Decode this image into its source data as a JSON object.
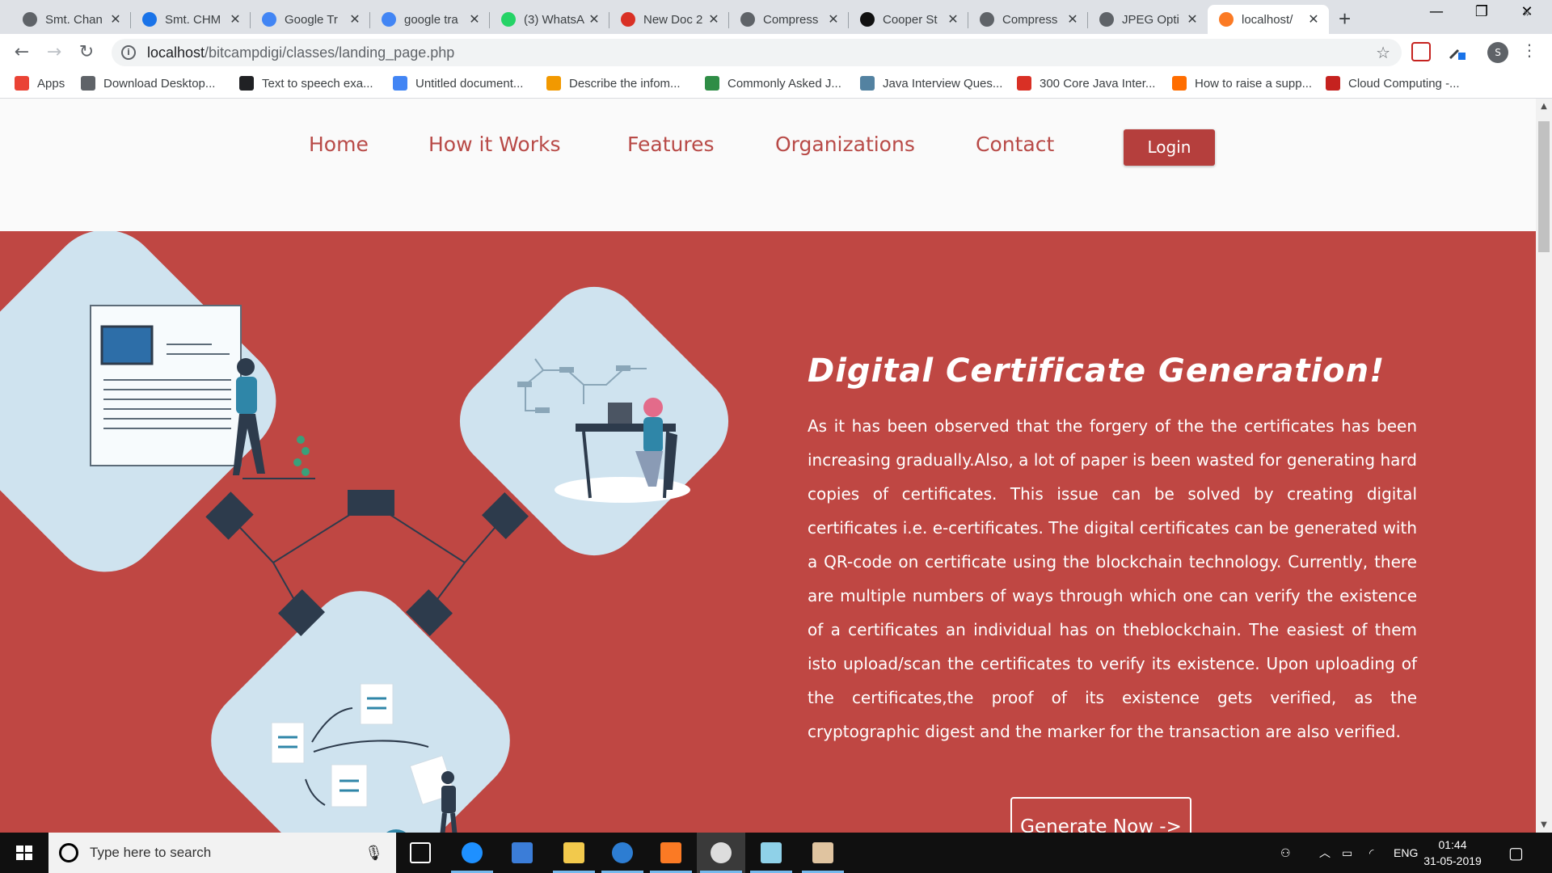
{
  "browser": {
    "tabs": [
      {
        "label": "Smt. Chan",
        "icon": "globe-icon",
        "color": "#5f6368"
      },
      {
        "label": "Smt. CHM",
        "icon": "a-logo-icon",
        "color": "#1a73e8"
      },
      {
        "label": "Google Tr",
        "icon": "google-translate-icon",
        "color": "#4285f4"
      },
      {
        "label": "google tra",
        "icon": "google-g-icon",
        "color": "#4285f4"
      },
      {
        "label": "(3) WhatsA",
        "icon": "whatsapp-icon",
        "color": "#25d366"
      },
      {
        "label": "New Doc 2",
        "icon": "gmail-icon",
        "color": "#d93025"
      },
      {
        "label": "Compress",
        "icon": "globe-icon",
        "color": "#5f6368"
      },
      {
        "label": "Cooper St",
        "icon": "m-logo-icon",
        "color": "#111111"
      },
      {
        "label": "Compress",
        "icon": "globe-icon",
        "color": "#5f6368"
      },
      {
        "label": "JPEG Opti",
        "icon": "globe-icon",
        "color": "#5f6368"
      },
      {
        "label": "localhost/",
        "icon": "xampp-icon",
        "color": "#fb7a24"
      }
    ],
    "new_tab_label": "+",
    "window_controls": {
      "minimize": "—",
      "restore": "❐",
      "close": "✕"
    },
    "url_host": "localhost",
    "url_path": "/bitcampdigi/classes/landing_page.php",
    "profile_initial": "S",
    "bookmarks": [
      {
        "label": "Apps",
        "icon": "apps-grid-icon"
      },
      {
        "label": "Download Desktop...",
        "icon": "bookmark-image-icon"
      },
      {
        "label": "Text to speech exa...",
        "icon": "bookmark-logo-icon"
      },
      {
        "label": "Untitled document...",
        "icon": "google-docs-icon"
      },
      {
        "label": "Describe the infom...",
        "icon": "quora-icon"
      },
      {
        "label": "Commonly Asked J...",
        "icon": "gfg-icon"
      },
      {
        "label": "Java Interview Ques...",
        "icon": "java-icon"
      },
      {
        "label": "300 Core Java Inter...",
        "icon": "javatpoint-icon"
      },
      {
        "label": "How to raise a supp...",
        "icon": "dots-icon"
      },
      {
        "label": "Cloud Computing -...",
        "icon": "n-logo-icon"
      }
    ],
    "bookmarks_more": "»"
  },
  "site": {
    "nav": [
      "Home",
      "How it Works",
      "Features",
      "Organizations",
      "Contact"
    ],
    "login_label": "Login",
    "hero": {
      "title": "Digital Certificate Generation!",
      "body": "As it has been observed that the forgery of the the certificates has been increasing gradually.Also, a lot of paper is been wasted for generating hard copies of certificates. This issue can be solved by creating digital certificates i.e. e-certificates. The digital certificates can be generated with a QR-code on certificate using the blockchain technology. Currently, there are multiple numbers of ways through which one can verify the existence of a certificates an individual has on theblockchain. The easiest of them isto upload/scan the certificates to verify its existence. Upon uploading of the certificates,the proof of its existence gets verified, as the cryptographic digest and the marker for the transaction are also verified.",
      "cta_label": "Generate Now ->"
    },
    "colors": {
      "brand": "#bf4743",
      "button": "#b53f3d",
      "panel": "#cfe3ef",
      "node": "#2d3b4c"
    }
  },
  "taskbar": {
    "search_placeholder": "Type here to search",
    "apps": [
      "task-view-icon",
      "edge-icon",
      "store-icon",
      "file-explorer-icon",
      "app-blue-icon",
      "xampp-icon",
      "chrome-icon",
      "notepad-icon",
      "paint-icon"
    ],
    "language": "ENG",
    "time": "01:44",
    "date": "31-05-2019"
  }
}
